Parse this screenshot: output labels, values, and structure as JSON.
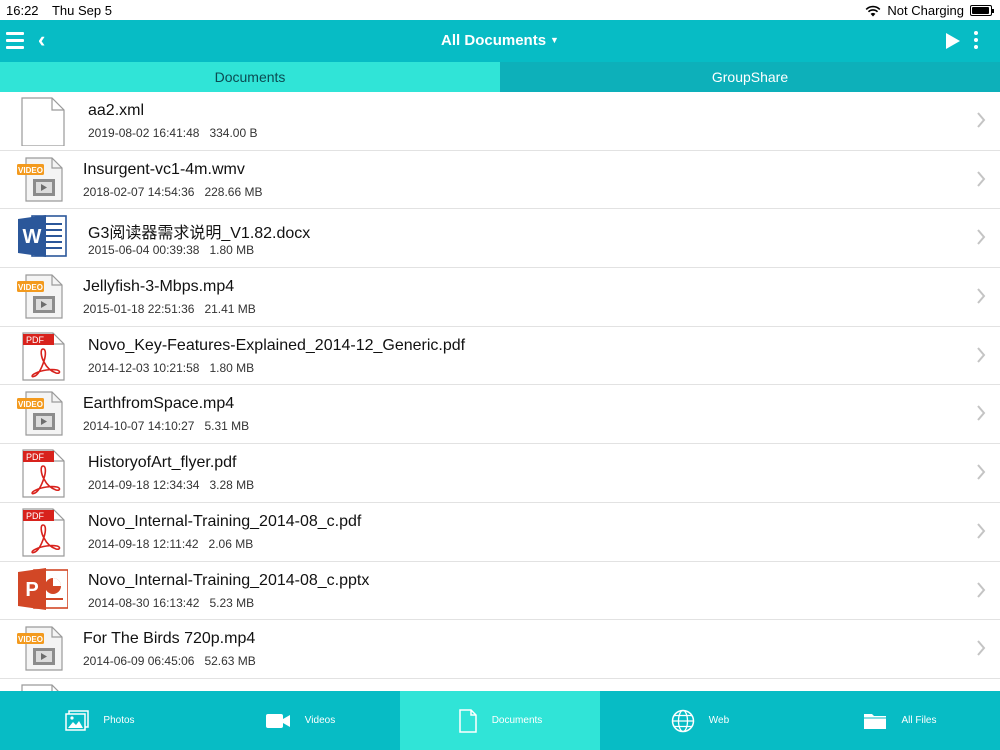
{
  "status_bar": {
    "time": "16:22",
    "date": "Thu Sep 5",
    "charging": "Not Charging"
  },
  "nav": {
    "title": "All Documents"
  },
  "segments": [
    "Documents",
    "GroupShare"
  ],
  "files": [
    {
      "name": "aa2.xml",
      "date": "2019-08-02 16:41:48",
      "size": "334.00 B",
      "type": "generic"
    },
    {
      "name": "Insurgent-vc1-4m.wmv",
      "date": "2018-02-07 14:54:36",
      "size": "228.66 MB",
      "type": "video"
    },
    {
      "name": "G3阅读器需求说明_V1.82.docx",
      "date": "2015-06-04 00:39:38",
      "size": "1.80 MB",
      "type": "word"
    },
    {
      "name": "Jellyfish-3-Mbps.mp4",
      "date": "2015-01-18 22:51:36",
      "size": "21.41 MB",
      "type": "video"
    },
    {
      "name": "Novo_Key-Features-Explained_2014-12_Generic.pdf",
      "date": "2014-12-03 10:21:58",
      "size": "1.80 MB",
      "type": "pdf"
    },
    {
      "name": "EarthfromSpace.mp4",
      "date": "2014-10-07 14:10:27",
      "size": "5.31 MB",
      "type": "video"
    },
    {
      "name": "HistoryofArt_flyer.pdf",
      "date": "2014-09-18 12:34:34",
      "size": "3.28 MB",
      "type": "pdf"
    },
    {
      "name": "Novo_Internal-Training_2014-08_c.pdf",
      "date": "2014-09-18 12:11:42",
      "size": "2.06 MB",
      "type": "pdf"
    },
    {
      "name": "Novo_Internal-Training_2014-08_c.pptx",
      "date": "2014-08-30 16:13:42",
      "size": "5.23 MB",
      "type": "ppt"
    },
    {
      "name": "For The Birds 720p.mp4",
      "date": "2014-06-09 06:45:06",
      "size": "52.63 MB",
      "type": "video"
    },
    {
      "name": "",
      "date": "",
      "size": "",
      "type": "generic"
    }
  ],
  "icon_labels": {
    "video": "VIDEO",
    "pdf": "PDF",
    "word": "W",
    "ppt": "P"
  },
  "tabs": [
    {
      "label": "Photos",
      "icon": "photos-icon"
    },
    {
      "label": "Videos",
      "icon": "video-camera-icon"
    },
    {
      "label": "Documents",
      "icon": "document-icon",
      "active": true
    },
    {
      "label": "Web",
      "icon": "globe-icon"
    },
    {
      "label": "All Files",
      "icon": "folder-icon"
    }
  ],
  "colors": {
    "nav": "#07bcc5",
    "active_tab": "#30e4d7",
    "segment_inactive": "#0db0ba",
    "video_badge": "#f39a1e",
    "pdf_red": "#d8221c",
    "word_blue": "#2b579a",
    "ppt_orange": "#d24726"
  }
}
